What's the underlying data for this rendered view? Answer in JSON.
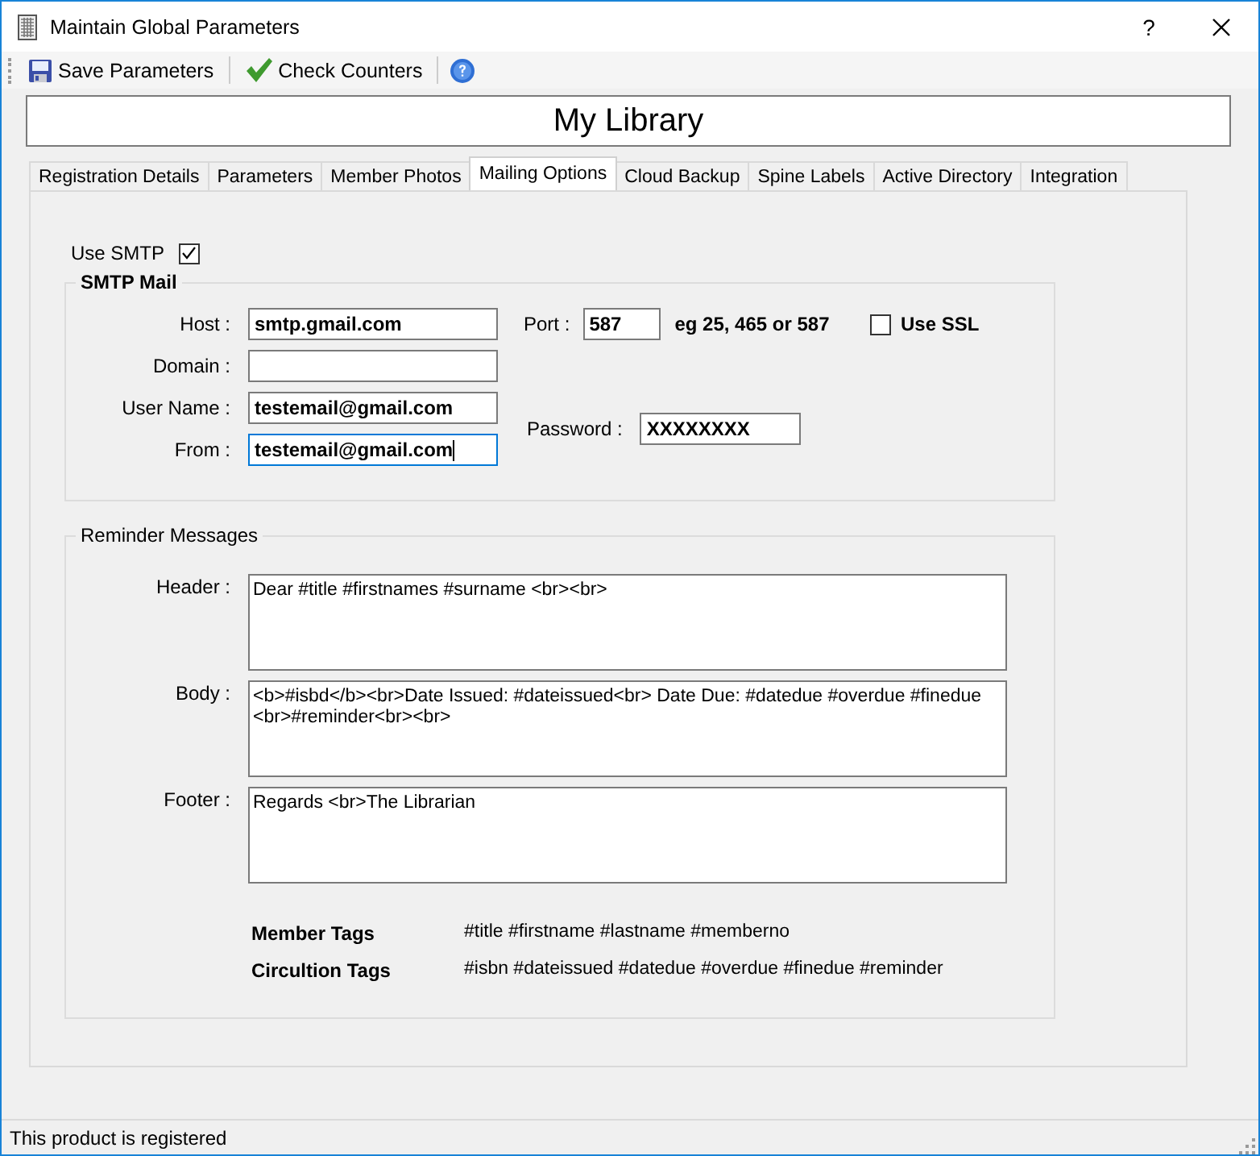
{
  "window": {
    "title": "Maintain Global Parameters",
    "help": "?"
  },
  "toolbar": [
    {
      "kind": "save",
      "label": "Save Parameters"
    },
    {
      "kind": "check",
      "label": "Check Counters"
    },
    {
      "kind": "help"
    }
  ],
  "library_name": "My Library",
  "tabs": [
    {
      "label": "Registration Details",
      "selected": false
    },
    {
      "label": "Parameters",
      "selected": false
    },
    {
      "label": "Member Photos",
      "selected": false
    },
    {
      "label": "Mailing Options",
      "selected": true
    },
    {
      "label": "Cloud Backup",
      "selected": false
    },
    {
      "label": "Spine Labels",
      "selected": false
    },
    {
      "label": "Active Directory",
      "selected": false
    },
    {
      "label": "Integration",
      "selected": false
    }
  ],
  "use_smtp": {
    "label": "Use SMTP",
    "checked": true
  },
  "smtp_mail": {
    "title": "SMTP Mail",
    "fields": [
      {
        "label": "Host :",
        "value": "smtp.gmail.com",
        "focused": false
      },
      {
        "label": "Domain :",
        "focused": false
      },
      {
        "label": "User Name :",
        "value": "testemail@gmail.com",
        "focused": false
      },
      {
        "label": "From :",
        "value": "testemail@gmail.com",
        "focused": true
      }
    ],
    "port": {
      "label": "Port :",
      "value": "587",
      "hint": "eg 25, 465 or 587"
    },
    "use_ssl": {
      "label": "Use SSL",
      "checked": false
    },
    "password": {
      "label": "Password :",
      "value": "XXXXXXXX"
    }
  },
  "reminder_messages": {
    "title": "Reminder Messages",
    "messages": [
      {
        "label": "Header :",
        "value": "Dear #title #firstnames #surname <br><br>"
      },
      {
        "label": "Body :",
        "value": "<b>#isbd</b><br>Date Issued: #dateissued<br> Date Due: #datedue #overdue #finedue <br>#reminder<br><br>"
      },
      {
        "label": "Footer :",
        "value": "Regards <br>The Librarian"
      }
    ],
    "tags": [
      {
        "label": "Member Tags",
        "value": "#title #firstname #lastname #memberno"
      },
      {
        "label": "Circultion Tags",
        "value": "#isbn #dateissued #datedue #overdue #finedue #reminder"
      }
    ]
  },
  "status_bar": {
    "text": "This product is registered"
  }
}
